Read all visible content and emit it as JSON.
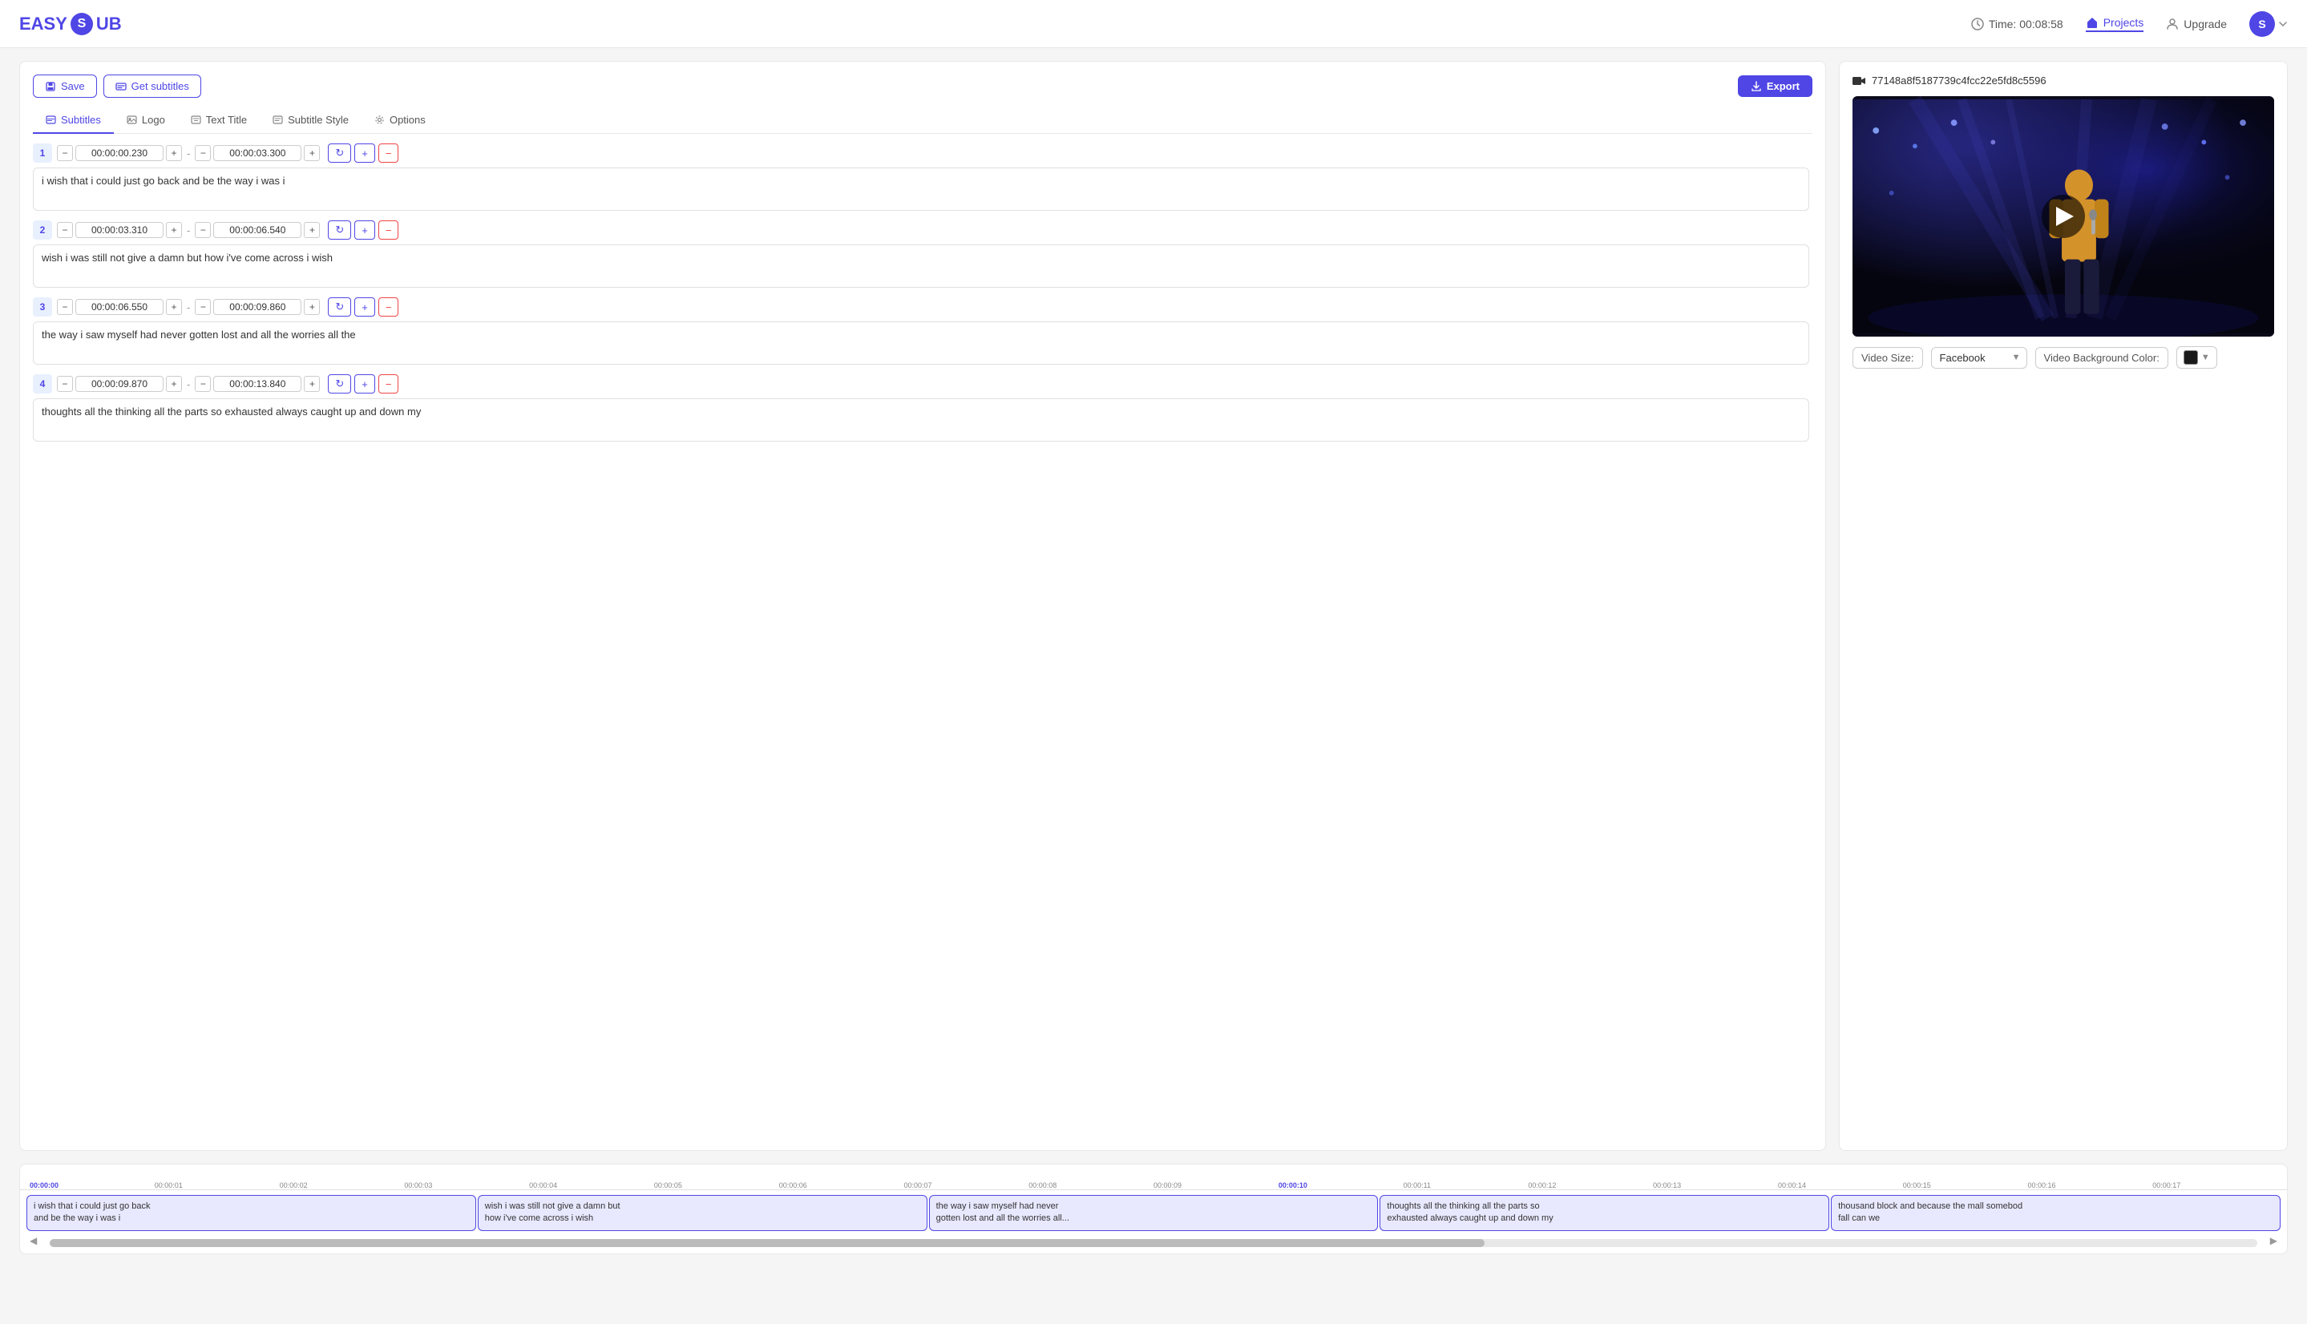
{
  "header": {
    "logo_text": "EASY",
    "logo_s": "S",
    "logo_sub": "UB",
    "time_label": "Time: 00:08:58",
    "projects_label": "Projects",
    "upgrade_label": "Upgrade",
    "avatar_letter": "S"
  },
  "toolbar": {
    "save_label": "Save",
    "get_subtitles_label": "Get subtitles",
    "export_label": "Export"
  },
  "tabs": [
    {
      "id": "subtitles",
      "label": "Subtitles",
      "active": true
    },
    {
      "id": "logo",
      "label": "Logo",
      "active": false
    },
    {
      "id": "text-title",
      "label": "Text Title",
      "active": false
    },
    {
      "id": "subtitle-style",
      "label": "Subtitle Style",
      "active": false
    },
    {
      "id": "options",
      "label": "Options",
      "active": false
    }
  ],
  "subtitles": [
    {
      "num": 1,
      "start": "00:00:00.230",
      "end": "00:00:03.300",
      "text": "i wish that i could just go back and be the way i was i"
    },
    {
      "num": 2,
      "start": "00:00:03.310",
      "end": "00:00:06.540",
      "text": "wish i was still not give a damn but how i've come across i wish"
    },
    {
      "num": 3,
      "start": "00:00:06.550",
      "end": "00:00:09.860",
      "text": "the way i saw myself had never gotten lost and all the worries all the"
    },
    {
      "num": 4,
      "start": "00:00:09.870",
      "end": "00:00:13.840",
      "text": "thoughts all the thinking all the parts so exhausted always caught up and down my"
    }
  ],
  "video": {
    "id": "77148a8f5187739c4fcc22e5fd8c5596",
    "size_label": "Video Size:",
    "size_value": "Facebook",
    "bg_color_label": "Video Background Color:",
    "bg_color": "#1a1a1a"
  },
  "timeline": {
    "ruler_marks": [
      "00:00:00",
      "00:00:01",
      "00:00:02",
      "00:00:03",
      "00:00:04",
      "00:00:05",
      "00:00:06",
      "00:00:07",
      "00:00:08",
      "00:00:09",
      "00:00:10",
      "00:00:11",
      "00:00:12",
      "00:00:13",
      "00:00:14",
      "00:00:15",
      "00:00:16",
      "00:00:17"
    ],
    "tracks": [
      {
        "text": "i wish that i could just go back\nand be the way i was i"
      },
      {
        "text": "wish i was still not give a damn but\nhow i've come across i wish"
      },
      {
        "text": "the way i saw myself had never\ngotten lost and all the worries all..."
      },
      {
        "text": "thoughts all the thinking all the parts so\nexhausted always caught up and down my"
      },
      {
        "text": "thousand block and because the mall somebod\nfall can we"
      }
    ]
  }
}
